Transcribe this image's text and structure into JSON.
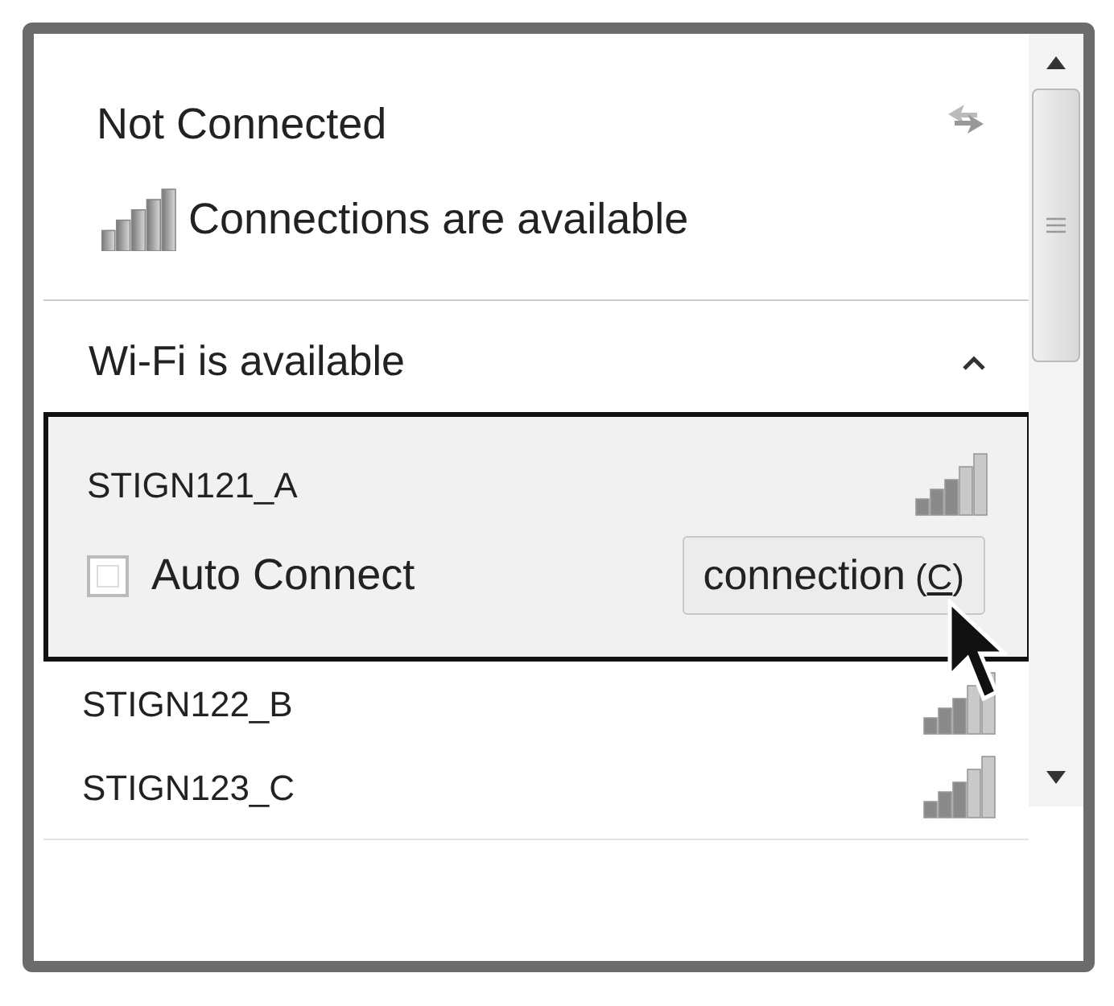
{
  "status": {
    "title": "Not Connected",
    "message": "Connections are available"
  },
  "section": {
    "title": "Wi-Fi is available",
    "expanded": true
  },
  "networks": [
    {
      "name": "STIGN121_A",
      "selected": true,
      "auto_connect": {
        "label": "Auto Connect",
        "checked": false
      },
      "button": {
        "label": "connection",
        "shortcut": "(C)"
      }
    },
    {
      "name": "STIGN122_B",
      "selected": false
    },
    {
      "name": "STIGN123_C",
      "selected": false
    }
  ]
}
